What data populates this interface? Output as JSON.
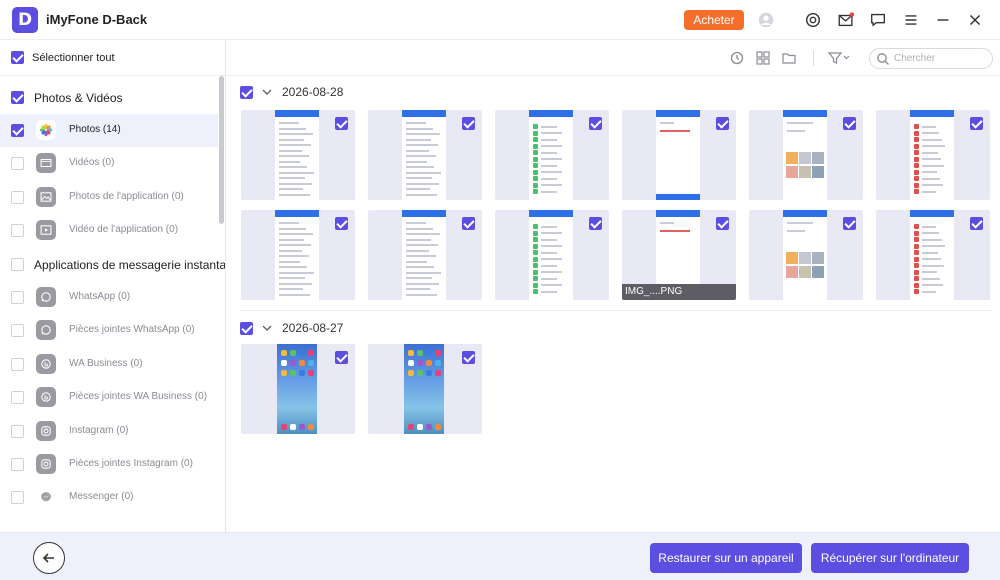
{
  "app": {
    "logo_letter": "D",
    "title": "iMyFone D-Back",
    "buy_label": "Acheter"
  },
  "sidebar": {
    "select_all": "Sélectionner tout",
    "categories": [
      {
        "label": "Photos & Vidéos",
        "checked": true
      },
      {
        "label": "Applications de messagerie instantanée",
        "checked": false
      }
    ],
    "items": [
      {
        "label": "Photos (14)",
        "icon": "photos-icon",
        "checked": true,
        "active": true
      },
      {
        "label": "Vidéos (0)",
        "icon": "video-icon",
        "checked": false,
        "active": false
      },
      {
        "label": "Photos de l'application (0)",
        "icon": "image-icon",
        "checked": false,
        "active": false
      },
      {
        "label": "Vidéo de l'application (0)",
        "icon": "play-icon",
        "checked": false,
        "active": false
      },
      {
        "label": "WhatsApp (0)",
        "icon": "whatsapp-icon",
        "checked": false,
        "active": false
      },
      {
        "label": "Pièces jointes WhatsApp (0)",
        "icon": "whatsapp-icon",
        "checked": false,
        "active": false
      },
      {
        "label": "WA Business (0)",
        "icon": "wa-business-icon",
        "checked": false,
        "active": false
      },
      {
        "label": "Pièces jointes WA Business (0)",
        "icon": "wa-business-icon",
        "checked": false,
        "active": false
      },
      {
        "label": "Instagram (0)",
        "icon": "instagram-icon",
        "checked": false,
        "active": false
      },
      {
        "label": "Pièces jointes Instagram (0)",
        "icon": "instagram-icon",
        "checked": false,
        "active": false
      },
      {
        "label": "Messenger (0)",
        "icon": "messenger-icon",
        "checked": false,
        "active": false
      }
    ]
  },
  "search": {
    "placeholder": "Chercher"
  },
  "groups": [
    {
      "date": "2026-08-28",
      "checked": true,
      "thumb_count": 12
    },
    {
      "date": "2026-08-27",
      "checked": true,
      "thumb_count": 2
    }
  ],
  "thumb_caption": "IMG_....PNG",
  "bottom": {
    "restore_device": "Restaurer sur un appareil",
    "recover_computer": "Récupérer sur l'ordinateur"
  },
  "colors": {
    "accent": "#5b4ee0",
    "buy": "#f56e2a",
    "bottom_bar": "#eef0fb"
  }
}
